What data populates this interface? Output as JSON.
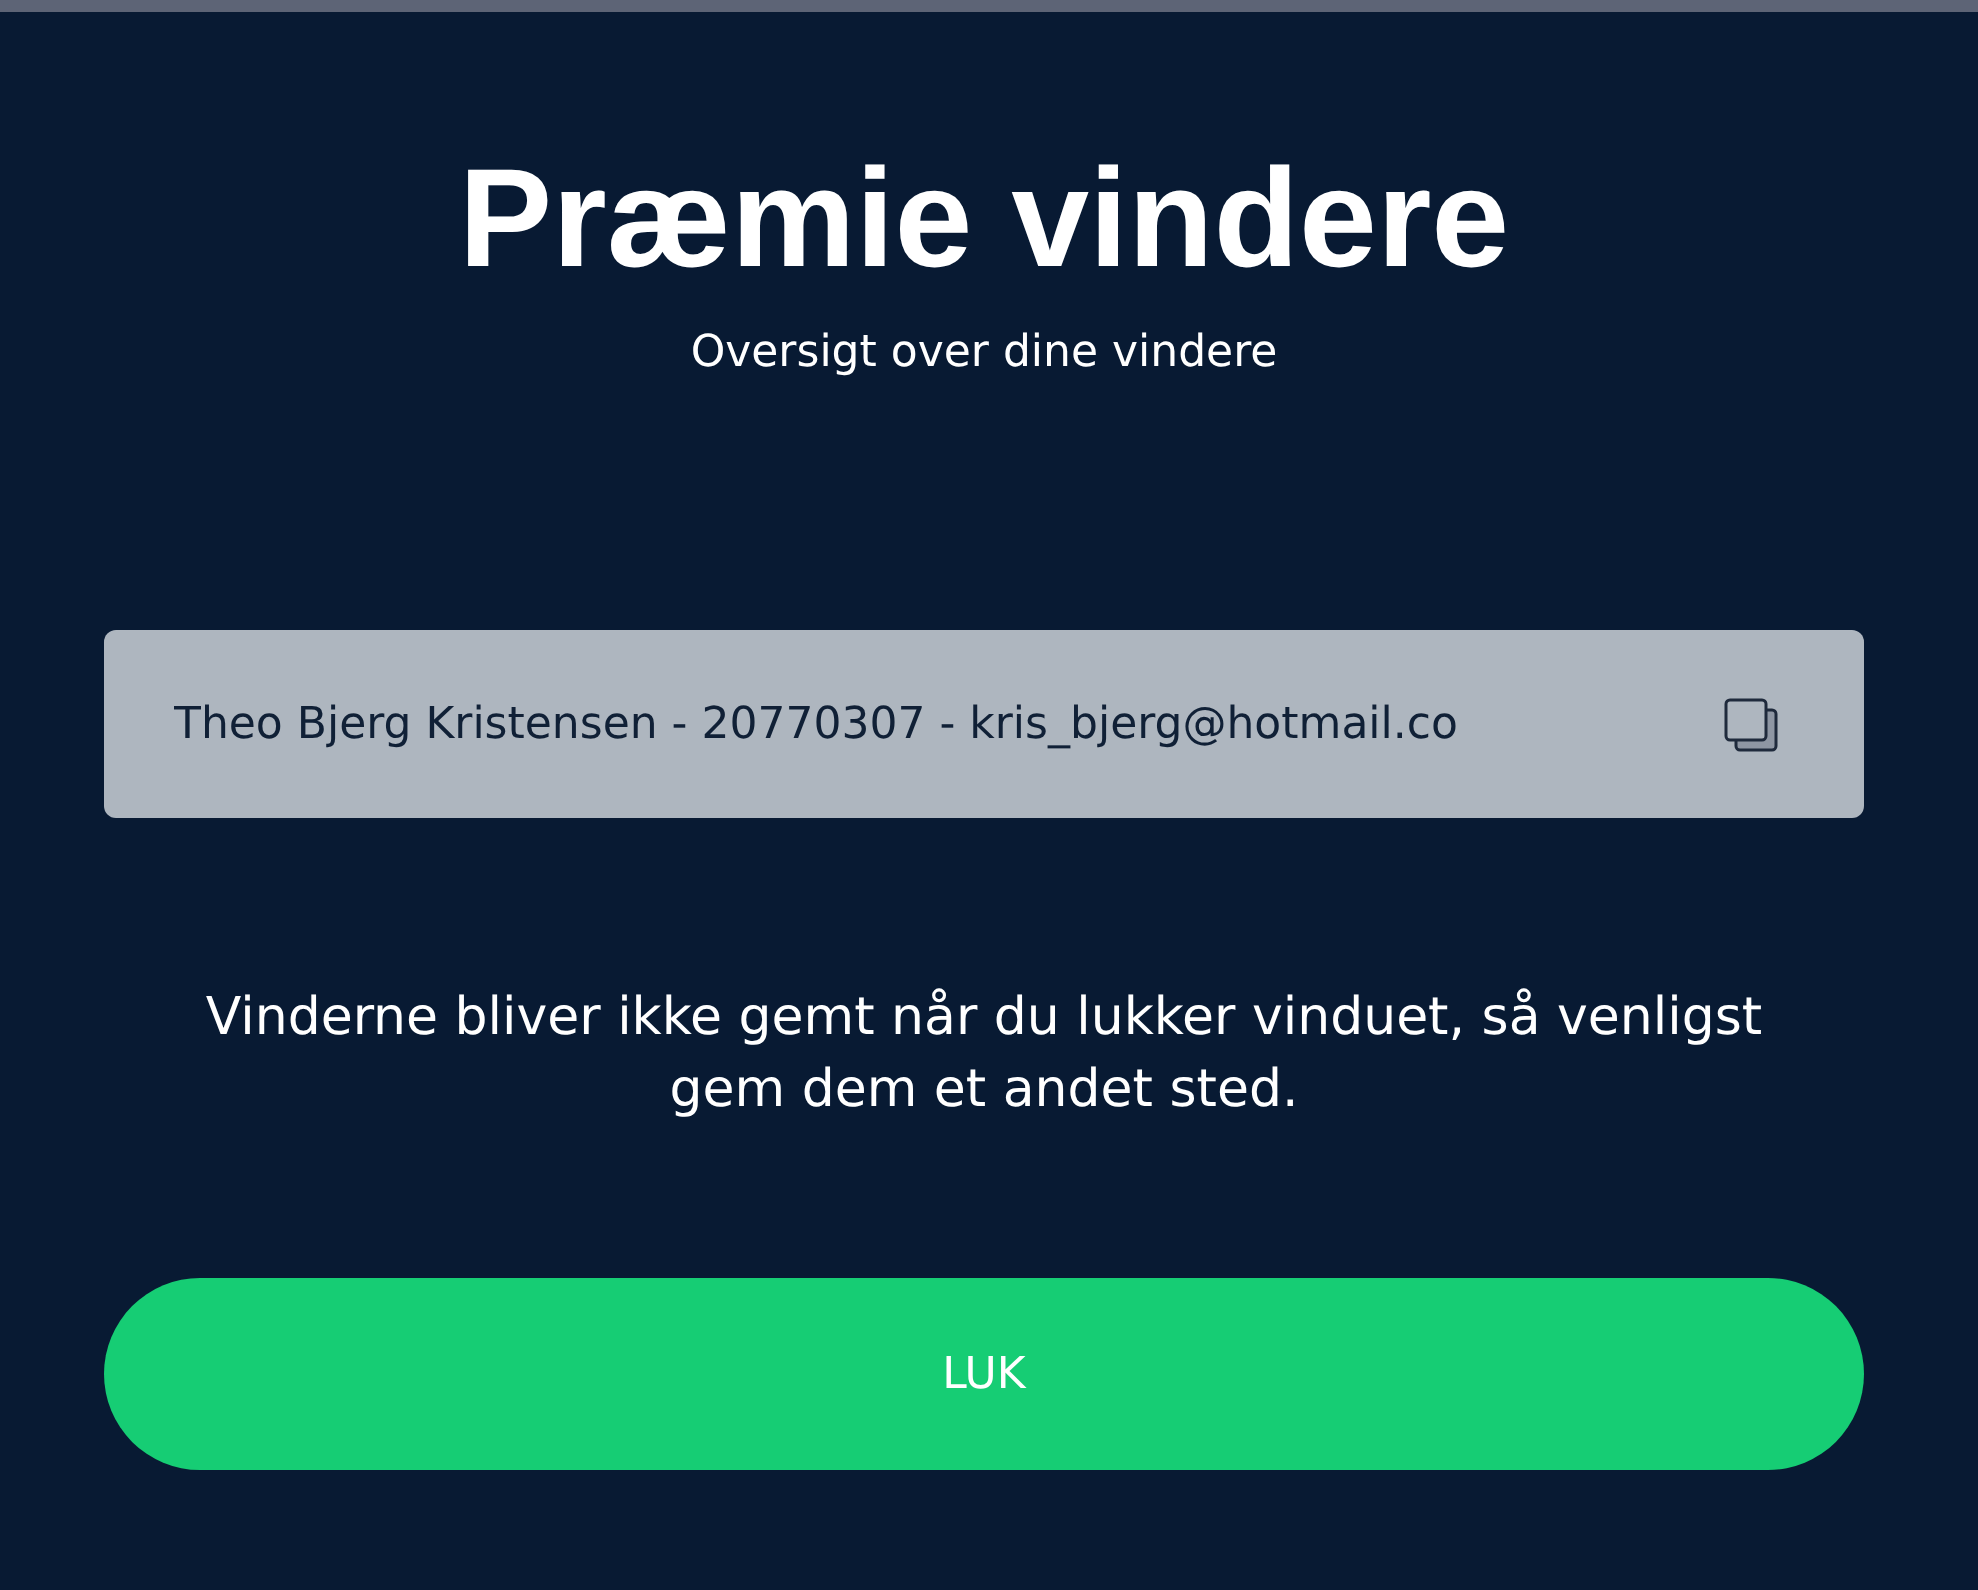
{
  "title": "Præmie vindere",
  "subtitle": "Oversigt over dine vindere",
  "winners": [
    {
      "text": "Theo Bjerg Kristensen - 20770307 - kris_bjerg@hotmail.co"
    }
  ],
  "notice": "Vinderne bliver ikke gemt når du lukker vinduet, så venligst gem dem et andet sted.",
  "close_button": "LUK"
}
